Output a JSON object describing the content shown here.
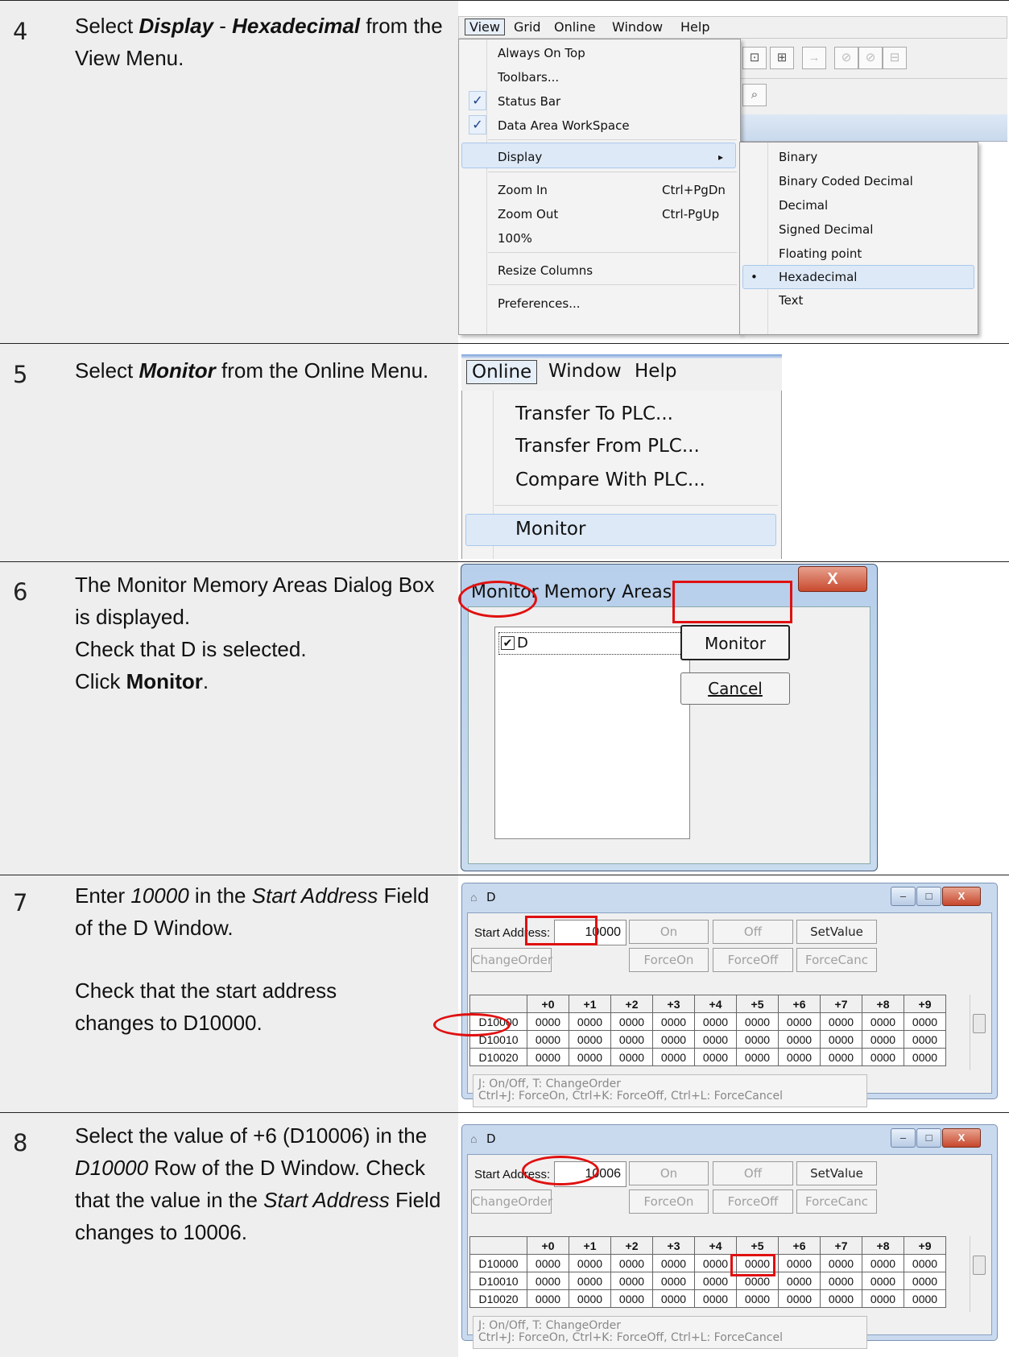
{
  "steps": [
    {
      "number": "4",
      "text_parts": [
        "Select ",
        "Display",
        " - ",
        "Hexadecimal",
        " from the View Menu."
      ]
    },
    {
      "number": "5",
      "text_parts": [
        "Select ",
        "Monitor",
        " from the Online Menu."
      ]
    },
    {
      "number": "6",
      "lines": [
        "The Monitor Memory Areas Dialog Box is displayed.",
        "Check that D is selected.",
        "Click "
      ],
      "bold": "Monitor",
      "tail": "."
    },
    {
      "number": "7",
      "text_parts": [
        "Enter ",
        "10000",
        " in the ",
        "Start Address",
        " Field of the D Window."
      ],
      "line2": "Check that the start address changes to D10000."
    },
    {
      "number": "8",
      "text_parts": [
        "Select the value of +6 (D10006) in the ",
        "D10000",
        " Row of the D Window. Check that the value in the ",
        "Start Address",
        " Field changes to 10006."
      ]
    }
  ],
  "view_menu": {
    "menubar": [
      "View",
      "Grid",
      "Online",
      "Window",
      "Help"
    ],
    "items": [
      "Always On Top",
      "Toolbars...",
      "Status Bar",
      "Data Area WorkSpace",
      "Display",
      "Zoom In",
      "Zoom Out",
      "100%",
      "Resize Columns",
      "Preferences..."
    ],
    "shortcuts": {
      "zoom_in": "Ctrl+PgDn",
      "zoom_out": "Ctrl-PgUp"
    },
    "checked": [
      "Status Bar",
      "Data Area WorkSpace"
    ],
    "check_glyph": "✓",
    "arrow_glyph": "▸",
    "display_submenu": [
      "Binary",
      "Binary Coded Decimal",
      "Decimal",
      "Signed Decimal",
      "Floating point",
      "Hexadecimal",
      "Text"
    ],
    "selected_bullet": "•",
    "selected": "Hexadecimal"
  },
  "online_menu": {
    "menubar": [
      "Online",
      "Window",
      "Help"
    ],
    "items": [
      "Transfer To PLC...",
      "Transfer From PLC...",
      "Compare With PLC...",
      "Monitor"
    ]
  },
  "monitor_dialog": {
    "title": "Monitor Memory Areas",
    "list_items": [
      "D"
    ],
    "checkbox_glyph": "✔",
    "close_glyph": "X",
    "monitor_button": "Monitor",
    "cancel_button": "Cancel"
  },
  "d_window": {
    "title": "D",
    "start_address_label": "Start Address:",
    "buttons": [
      "On",
      "Off",
      "SetValue",
      "ChangeOrder",
      "ForceOn",
      "ForceOff",
      "ForceCanc"
    ],
    "columns": [
      "+0",
      "+1",
      "+2",
      "+3",
      "+4",
      "+5",
      "+6",
      "+7",
      "+8",
      "+9"
    ],
    "rows": [
      {
        "addr": "D10000",
        "values": [
          "0000",
          "0000",
          "0000",
          "0000",
          "0000",
          "0000",
          "0000",
          "0000",
          "0000",
          "0000"
        ]
      },
      {
        "addr": "D10010",
        "values": [
          "0000",
          "0000",
          "0000",
          "0000",
          "0000",
          "0000",
          "0000",
          "0000",
          "0000",
          "0000"
        ]
      },
      {
        "addr": "D10020",
        "values": [
          "0000",
          "0000",
          "0000",
          "0000",
          "0000",
          "0000",
          "0000",
          "0000",
          "0000",
          "0000"
        ]
      }
    ],
    "hint_line1": "J: On/Off,   T: ChangeOrder",
    "hint_line2": "Ctrl+J: ForceOn,   Ctrl+K: ForceOff,   Ctrl+L: ForceCancel",
    "window_buttons": [
      "–",
      "□",
      "X"
    ],
    "step7_address": "10000",
    "step8_address": "10006"
  }
}
